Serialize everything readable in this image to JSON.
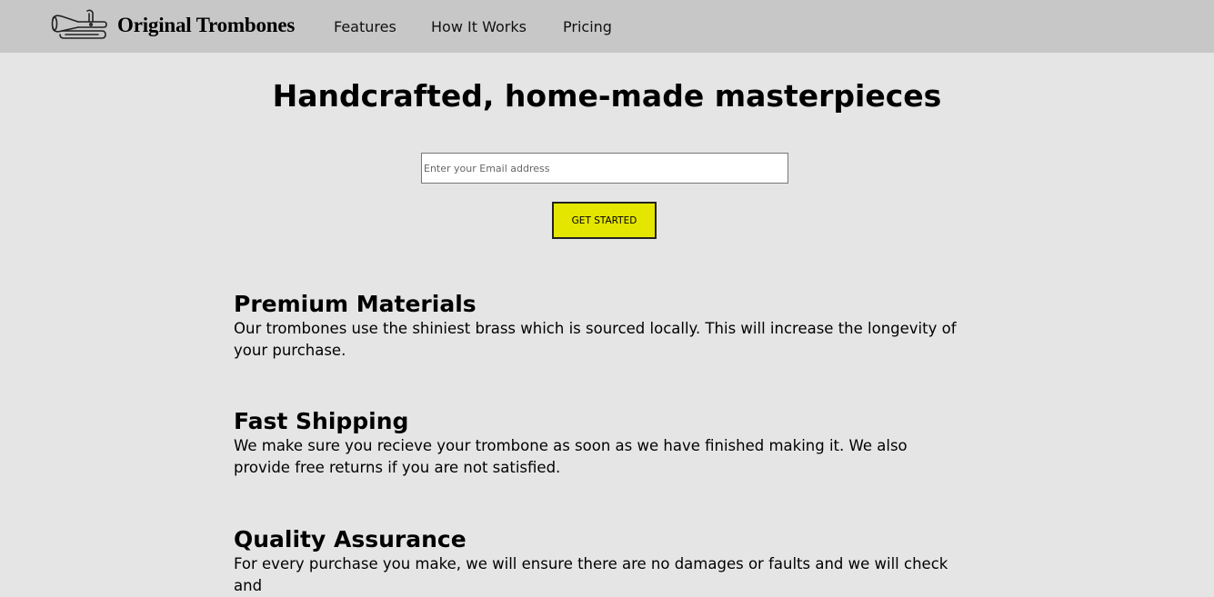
{
  "header": {
    "brand": "Original Trombones",
    "logo_icon": "trombone-icon",
    "nav": [
      {
        "label": "Features"
      },
      {
        "label": "How It Works"
      },
      {
        "label": "Pricing"
      }
    ]
  },
  "hero": {
    "title": "Handcrafted, home-made masterpieces",
    "email_placeholder": "Enter your Email address",
    "email_value": "",
    "cta_label": "GET STARTED"
  },
  "features": [
    {
      "title": "Premium Materials",
      "description": "Our trombones use the shiniest brass which is sourced locally. This will increase the longevity of your purchase."
    },
    {
      "title": "Fast Shipping",
      "description": "We make sure you recieve your trombone as soon as we have finished making it. We also provide free returns if you are not satisfied."
    },
    {
      "title": "Quality Assurance",
      "description": "For every purchase you make, we will ensure there are no damages or faults and we will check and"
    }
  ],
  "colors": {
    "header_bg": "#c8c7c7",
    "page_bg": "#e5e5e5",
    "cta_bg": "#e5e600"
  }
}
